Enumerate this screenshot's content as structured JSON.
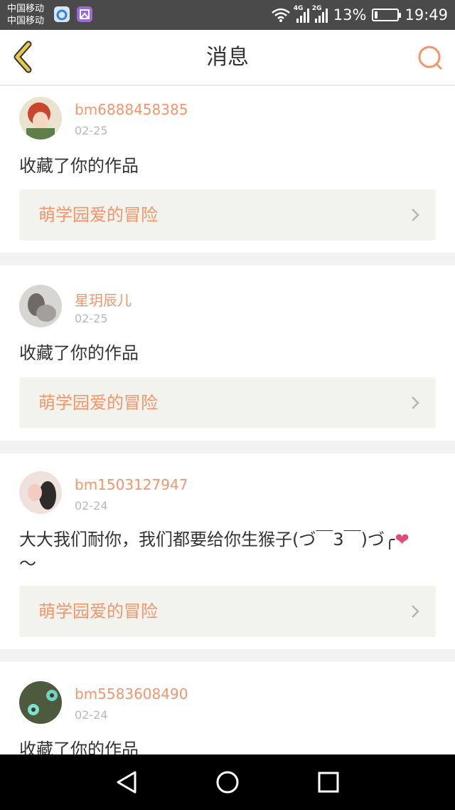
{
  "status_bar": {
    "carrier1": "中国移动",
    "carrier2": "中国移动",
    "net1": "4G",
    "net2": "2G",
    "battery": "13%",
    "battery_level": 0.13,
    "time": "19:49",
    "icons": [
      "app-icon",
      "gallery-icon",
      "wifi-icon",
      "signal-icon",
      "battery-icon"
    ]
  },
  "header": {
    "title": "消息",
    "back_icon": "chevron-left-icon",
    "search_icon": "search-icon",
    "accent": "#f2956b"
  },
  "messages": [
    {
      "name": "bm6888458385",
      "date": "02-25",
      "text": "收藏了你的作品",
      "work": "萌学园爱的冒险"
    },
    {
      "name": "星玥辰儿",
      "date": "02-25",
      "text": "收藏了你的作品",
      "work": "萌学园爱的冒险"
    },
    {
      "name": "bm1503127947",
      "date": "02-24",
      "text": "大大我们耐你，我们都要给你生猴子(づ￣3￣)づ╭",
      "text_heart": "❤",
      "text_line2": "～",
      "work": "萌学园爱的冒险"
    },
    {
      "name": "bm5583608490",
      "date": "02-24",
      "text": "收藏了你的作品"
    }
  ],
  "nav_bar": {
    "icons": [
      "back-triangle-icon",
      "home-circle-icon",
      "recents-square-icon"
    ]
  }
}
